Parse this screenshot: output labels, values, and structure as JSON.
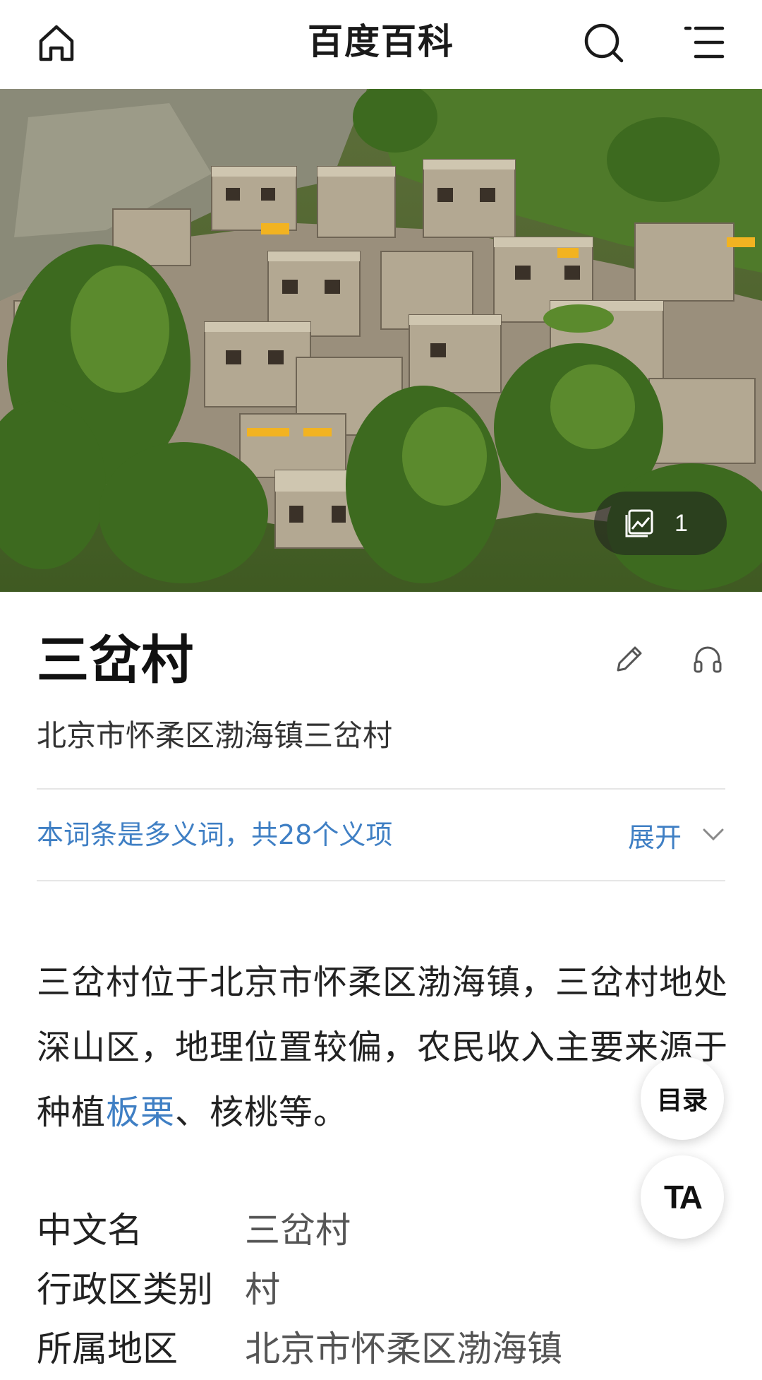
{
  "header": {
    "title": "百度百科"
  },
  "hero": {
    "photo_count": "1"
  },
  "entry": {
    "title": "三岔村",
    "subtitle": "北京市怀柔区渤海镇三岔村"
  },
  "polysemy": {
    "text": "本词条是多义词，共28个义项",
    "expand_label": "展开"
  },
  "summary": {
    "part1": "三岔村位于北京市怀柔区渤海镇，三岔村地处深山区，地理位置较偏，农民收入主要来源于种植",
    "link": "板栗",
    "part2": "、核桃等。"
  },
  "infobox": {
    "rows": [
      {
        "key": "中文名",
        "value": "三岔村"
      },
      {
        "key": "行政区类别",
        "value": "村"
      },
      {
        "key": "所属地区",
        "value": "北京市怀柔区渤海镇"
      }
    ]
  },
  "floating": {
    "toc_label": "目录",
    "ta_label": "TA"
  },
  "colors": {
    "accent": "#3f7fc4",
    "text": "#222222",
    "muted": "#555555"
  }
}
